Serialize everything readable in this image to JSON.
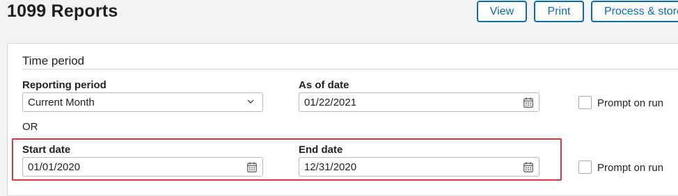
{
  "header": {
    "title": "1099 Reports",
    "buttons": {
      "view": "View",
      "print": "Print",
      "process": "Process & store"
    }
  },
  "time_period": {
    "section_title": "Time period",
    "reporting_period": {
      "label": "Reporting period",
      "value": "Current Month",
      "icon": "chevron-down-icon"
    },
    "as_of_date": {
      "label": "As of date",
      "value": "01/22/2021",
      "icon": "calendar-icon"
    },
    "prompt_on_run_1": {
      "label": "Prompt on run",
      "checked": false
    },
    "or_label": "OR",
    "start_date": {
      "label": "Start date",
      "value": "01/01/2020",
      "icon": "calendar-icon"
    },
    "end_date": {
      "label": "End date",
      "value": "12/31/2020",
      "icon": "calendar-icon"
    },
    "prompt_on_run_2": {
      "label": "Prompt on run",
      "checked": false
    }
  },
  "colors": {
    "accent": "#0a6cad",
    "highlight": "#e0353f",
    "background": "#f2f2f2"
  }
}
